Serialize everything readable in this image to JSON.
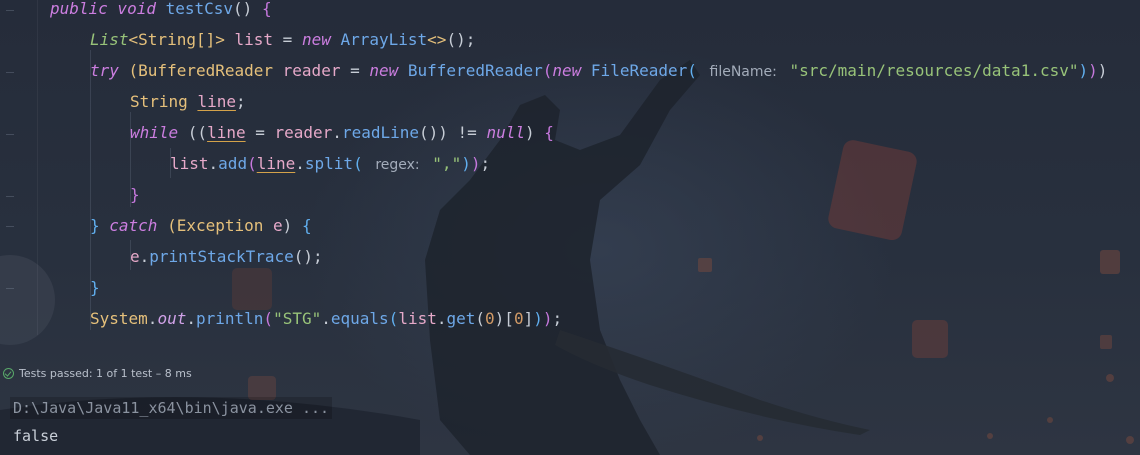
{
  "editor": {
    "lines": [
      {
        "indent": 0,
        "tokens": [
          {
            "t": "public void ",
            "c": "kw"
          },
          {
            "t": "testCsv",
            "c": "fn"
          },
          {
            "t": "() ",
            "c": "plain"
          },
          {
            "t": "{",
            "c": "brace-p"
          }
        ]
      },
      {
        "indent": 1,
        "tokens": [
          {
            "t": "List",
            "c": "tyi"
          },
          {
            "t": "<String[]> ",
            "c": "ty2"
          },
          {
            "t": "list",
            "c": "var"
          },
          {
            "t": " = ",
            "c": "plain"
          },
          {
            "t": "new ",
            "c": "kw"
          },
          {
            "t": "ArrayList",
            "c": "fn"
          },
          {
            "t": "<>",
            "c": "ty2"
          },
          {
            "t": "();",
            "c": "plain"
          }
        ]
      },
      {
        "indent": 1,
        "tokens": [
          {
            "t": "try ",
            "c": "kw"
          },
          {
            "t": "(BufferedReader ",
            "c": "ty2"
          },
          {
            "t": "reader",
            "c": "var"
          },
          {
            "t": " = ",
            "c": "plain"
          },
          {
            "t": "new ",
            "c": "kw"
          },
          {
            "t": "BufferedReader",
            "c": "fn"
          },
          {
            "t": "(",
            "c": "brace-p"
          },
          {
            "t": "new ",
            "c": "kw"
          },
          {
            "t": "FileReader",
            "c": "fn"
          },
          {
            "t": "( ",
            "c": "brace-b"
          },
          {
            "t": "fileName:",
            "c": "hint"
          },
          {
            "t": " ",
            "c": "plain"
          },
          {
            "t": "\"src/main/resources/data1.csv\"",
            "c": "str"
          },
          {
            "t": ")",
            "c": "brace-b"
          },
          {
            "t": ")",
            "c": "brace-p"
          },
          {
            "t": ")",
            "c": "plain"
          }
        ]
      },
      {
        "indent": 2,
        "tokens": [
          {
            "t": "String ",
            "c": "ty2"
          },
          {
            "t": "line",
            "c": "var ul"
          },
          {
            "t": ";",
            "c": "plain"
          }
        ]
      },
      {
        "indent": 2,
        "tokens": [
          {
            "t": "while ",
            "c": "kw"
          },
          {
            "t": "((",
            "c": "plain"
          },
          {
            "t": "line",
            "c": "var ul"
          },
          {
            "t": " = ",
            "c": "plain"
          },
          {
            "t": "reader",
            "c": "var"
          },
          {
            "t": ".",
            "c": "plain"
          },
          {
            "t": "readLine",
            "c": "fn"
          },
          {
            "t": "()) != ",
            "c": "plain"
          },
          {
            "t": "null",
            "c": "kw"
          },
          {
            "t": ") ",
            "c": "plain"
          },
          {
            "t": "{",
            "c": "brace-p"
          }
        ]
      },
      {
        "indent": 3,
        "tokens": [
          {
            "t": "list",
            "c": "var"
          },
          {
            "t": ".",
            "c": "plain"
          },
          {
            "t": "add",
            "c": "fn"
          },
          {
            "t": "(",
            "c": "brace-p"
          },
          {
            "t": "line",
            "c": "var ul"
          },
          {
            "t": ".",
            "c": "plain"
          },
          {
            "t": "split",
            "c": "fn"
          },
          {
            "t": "( ",
            "c": "brace-b"
          },
          {
            "t": "regex:",
            "c": "hint"
          },
          {
            "t": " ",
            "c": "plain"
          },
          {
            "t": "\",\"",
            "c": "str"
          },
          {
            "t": ")",
            "c": "brace-b"
          },
          {
            "t": ")",
            "c": "brace-p"
          },
          {
            "t": ";",
            "c": "plain"
          }
        ]
      },
      {
        "indent": 2,
        "tokens": [
          {
            "t": "}",
            "c": "brace-p"
          }
        ]
      },
      {
        "indent": 1,
        "tokens": [
          {
            "t": "} ",
            "c": "brace-b"
          },
          {
            "t": "catch ",
            "c": "kw"
          },
          {
            "t": "(Exception ",
            "c": "ty2"
          },
          {
            "t": "e",
            "c": "var"
          },
          {
            "t": ") ",
            "c": "plain"
          },
          {
            "t": "{",
            "c": "brace-b"
          }
        ]
      },
      {
        "indent": 2,
        "tokens": [
          {
            "t": "e",
            "c": "var"
          },
          {
            "t": ".",
            "c": "plain"
          },
          {
            "t": "printStackTrace",
            "c": "fn"
          },
          {
            "t": "();",
            "c": "plain"
          }
        ]
      },
      {
        "indent": 1,
        "tokens": [
          {
            "t": "}",
            "c": "brace-b"
          }
        ]
      },
      {
        "indent": 1,
        "tokens": [
          {
            "t": "System",
            "c": "ty2"
          },
          {
            "t": ".",
            "c": "plain"
          },
          {
            "t": "out",
            "c": "field"
          },
          {
            "t": ".",
            "c": "plain"
          },
          {
            "t": "println",
            "c": "fn"
          },
          {
            "t": "(",
            "c": "brace-p"
          },
          {
            "t": "\"STG\"",
            "c": "str"
          },
          {
            "t": ".",
            "c": "plain"
          },
          {
            "t": "equals",
            "c": "fn"
          },
          {
            "t": "(",
            "c": "brace-b"
          },
          {
            "t": "list",
            "c": "var"
          },
          {
            "t": ".",
            "c": "plain"
          },
          {
            "t": "get",
            "c": "fn"
          },
          {
            "t": "(",
            "c": "plain"
          },
          {
            "t": "0",
            "c": "num"
          },
          {
            "t": ")[",
            "c": "plain"
          },
          {
            "t": "0",
            "c": "num"
          },
          {
            "t": "]",
            "c": "plain"
          },
          {
            "t": ")",
            "c": "brace-b"
          },
          {
            "t": ")",
            "c": "brace-p"
          },
          {
            "t": ";",
            "c": "plain"
          }
        ]
      }
    ]
  },
  "run": {
    "status_icon": "check-circle-icon",
    "status_text": "Tests passed: 1 of 1 test – 8 ms",
    "command": "D:\\Java\\Java11_x64\\bin\\java.exe ...",
    "output": "false"
  },
  "colors": {
    "background": "#262d3b",
    "keyword": "#cc7ee0",
    "method": "#6ea8e8",
    "string": "#98c379",
    "variable": "#e6a9c9",
    "type": "#e5c07b",
    "pass": "#59a869"
  }
}
